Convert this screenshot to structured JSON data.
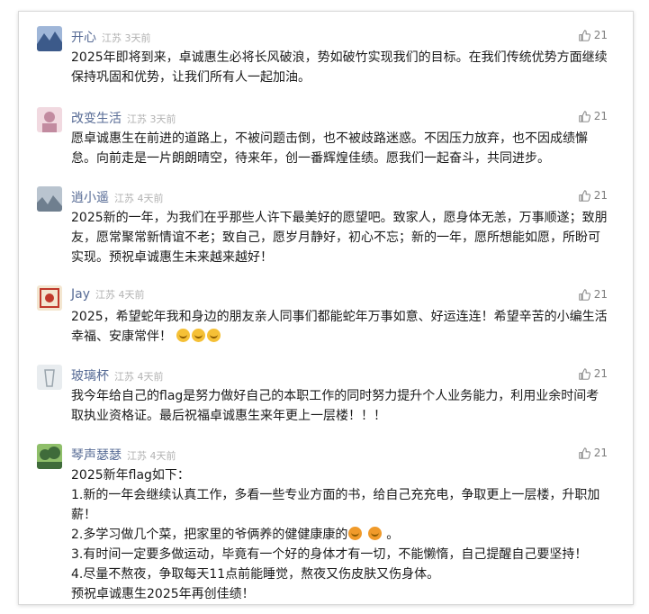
{
  "comments": [
    {
      "name": "开心",
      "meta": "江苏 3天前",
      "likes": "21",
      "avatar_colors": [
        "#3c5a8a",
        "#9fb6d8"
      ],
      "text": "2025年即将到来，卓诚惠生必将长风破浪，势如破竹实现我们的目标。在我们传统优势方面继续保持巩固和优势，让我们所有人一起加油。"
    },
    {
      "name": "改变生活",
      "meta": "江苏 3天前",
      "likes": "21",
      "avatar_colors": [
        "#c28ba0",
        "#f1d9e0"
      ],
      "text": "愿卓诚惠生在前进的道路上，不被问题击倒，也不被歧路迷惑。不因压力放弃，也不因成绩懈怠。向前走是一片朗朗晴空，待来年，创一番辉煌佳绩。愿我们一起奋斗，共同进步。"
    },
    {
      "name": "逍小遥",
      "meta": "江苏 4天前",
      "likes": "21",
      "avatar_colors": [
        "#6f7f8f",
        "#b9c4cf"
      ],
      "text": "2025新的一年，为我们在乎那些人许下最美好的愿望吧。致家人，愿身体无恙，万事顺遂；致朋友，愿常聚常新情谊不老；致自己，愿岁月静好，初心不忘；新的一年，愿所想能如愿，所盼可实现。预祝卓诚惠生未来越来越好！"
    },
    {
      "name": "Jay",
      "meta": "江苏 4天前",
      "likes": "21",
      "avatar_colors": [
        "#c0392b",
        "#f3e6d0"
      ],
      "text": "2025，希望蛇年我和身边的朋友亲人同事们都能蛇年万事如意、好运连连！希望辛苦的小编生活幸福、安康常伴！",
      "emoji_count": 3
    },
    {
      "name": "玻璃杯",
      "meta": "江苏 4天前",
      "likes": "21",
      "avatar_colors": [
        "#9aa5ad",
        "#e8ecef"
      ],
      "text": "我今年给自己的flag是努力做好自己的本职工作的同时努力提升个人业务能力，利用业余时间考取执业资格证。最后祝福卓诚惠生来年更上一层楼！！！"
    },
    {
      "name": "琴声瑟瑟",
      "meta": "江苏 4天前",
      "likes": "21",
      "avatar_colors": [
        "#3f6b3a",
        "#8fbf6a"
      ],
      "lines": [
        "2025新年flag如下：",
        "1.新的一年会继续认真工作，多看一些专业方面的书，给自己充充电，争取更上一层楼，升职加薪！",
        "2.多学习做几个菜，把家里的爷俩养的健健康康的",
        "3.有时间一定要多做运动，毕竟有一个好的身体才有一切，不能懒惰，自己提醒自己要坚持！",
        "4.尽量不熬夜，争取每天11点前能睡觉，熬夜又伤皮肤又伤身体。",
        "预祝卓诚惠生2025年再创佳绩！"
      ],
      "line2_tail": "。"
    }
  ]
}
